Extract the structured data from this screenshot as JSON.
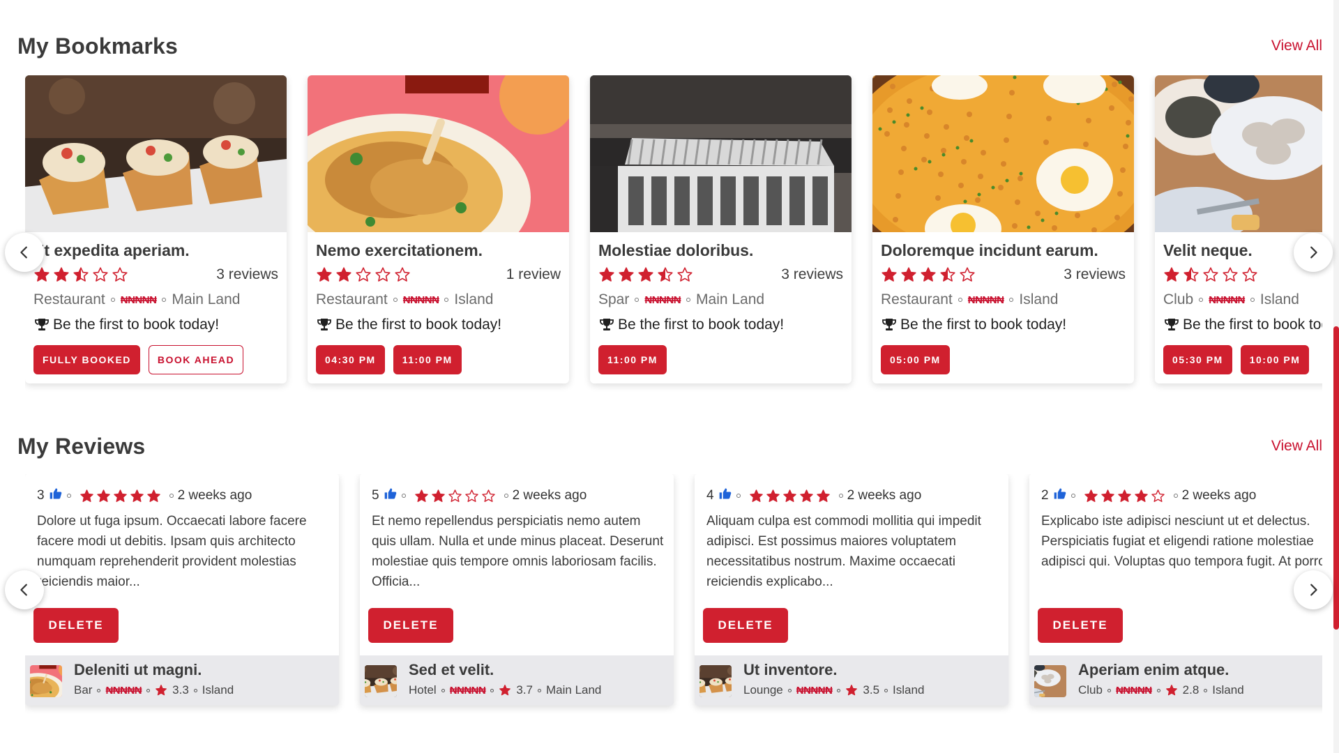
{
  "colors": {
    "accent": "#d0202f",
    "star": "#d0202f",
    "thumb_blue": "#1f63d8",
    "footer_bg": "#e9e9ec"
  },
  "bookmarks": {
    "title": "My Bookmarks",
    "view_all": "View All",
    "prev_icon": "chevron-left-icon",
    "next_icon": "chevron-right-icon",
    "be_first": "Be the first to book today!",
    "cards": [
      {
        "name": "Et expedita aperiam.",
        "rating": 2.5,
        "reviews": "3 reviews",
        "category": "Restaurant",
        "price": "₦₦₦₦₦",
        "location": "Main Land",
        "times": [
          "FULLY BOOKED",
          "BOOK AHEAD"
        ],
        "image": "tacos"
      },
      {
        "name": "Nemo exercitationem.",
        "rating": 2,
        "reviews": "1 review",
        "category": "Restaurant",
        "price": "₦₦₦₦₦",
        "location": "Island",
        "times": [
          "04:30 PM",
          "11:00 PM"
        ],
        "image": "chicken"
      },
      {
        "name": "Molestiae doloribus.",
        "rating": 3.5,
        "reviews": "3 reviews",
        "category": "Spar",
        "price": "₦₦₦₦₦",
        "location": "Main Land",
        "times": [
          "11:00 PM"
        ],
        "image": "building"
      },
      {
        "name": "Doloremque incidunt earum.",
        "rating": 3.5,
        "reviews": "3 reviews",
        "category": "Restaurant",
        "price": "₦₦₦₦₦",
        "location": "Island",
        "times": [
          "05:00 PM"
        ],
        "image": "paella"
      },
      {
        "name": "Velit neque.",
        "rating": 1.5,
        "reviews": "",
        "category": "Club",
        "price": "₦₦₦₦₦",
        "location": "Island",
        "times": [
          "05:30 PM",
          "10:00 PM"
        ],
        "image": "oysters"
      }
    ]
  },
  "reviews": {
    "title": "My Reviews",
    "view_all": "View All",
    "delete_label": "DELETE",
    "cards": [
      {
        "likes": "3",
        "rating": 5,
        "time": "2 weeks ago",
        "text": "Dolore ut fuga ipsum. Occaecati labore facere facere modi ut debitis. Ipsam quis architecto numquam reprehenderit provident molestias reiciendis maior...",
        "place": "Deleniti ut magni.",
        "type": "Bar",
        "price": "₦₦₦₦₦",
        "score": "3.3",
        "location": "Island"
      },
      {
        "likes": "5",
        "rating": 2,
        "time": "2 weeks ago",
        "text": "Et nemo repellendus perspiciatis nemo autem quis ullam. Nulla et unde minus placeat. Deserunt molestiae quis tempore omnis laboriosam facilis. Officia...",
        "place": "Sed et velit.",
        "type": "Hotel",
        "price": "₦₦₦₦₦",
        "score": "3.7",
        "location": "Main Land"
      },
      {
        "likes": "4",
        "rating": 5,
        "time": "2 weeks ago",
        "text": "Aliquam culpa est commodi mollitia qui impedit adipisci. Est possimus maiores voluptatem necessitatibus nostrum. Maxime occaecati reiciendis explicabo...",
        "place": "Ut inventore.",
        "type": "Lounge",
        "price": "₦₦₦₦₦",
        "score": "3.5",
        "location": "Island"
      },
      {
        "likes": "2",
        "rating": 4,
        "time": "2 weeks ago",
        "text": "Explicabo iste adipisci nesciunt ut et delectus. Perspiciatis fugiat et eligendi ratione molestiae adipisci qui. Voluptas quo tempora fugit. At porro...",
        "place": "Aperiam enim atque.",
        "type": "Club",
        "price": "₦₦₦₦₦",
        "score": "2.8",
        "location": "Island"
      }
    ]
  }
}
